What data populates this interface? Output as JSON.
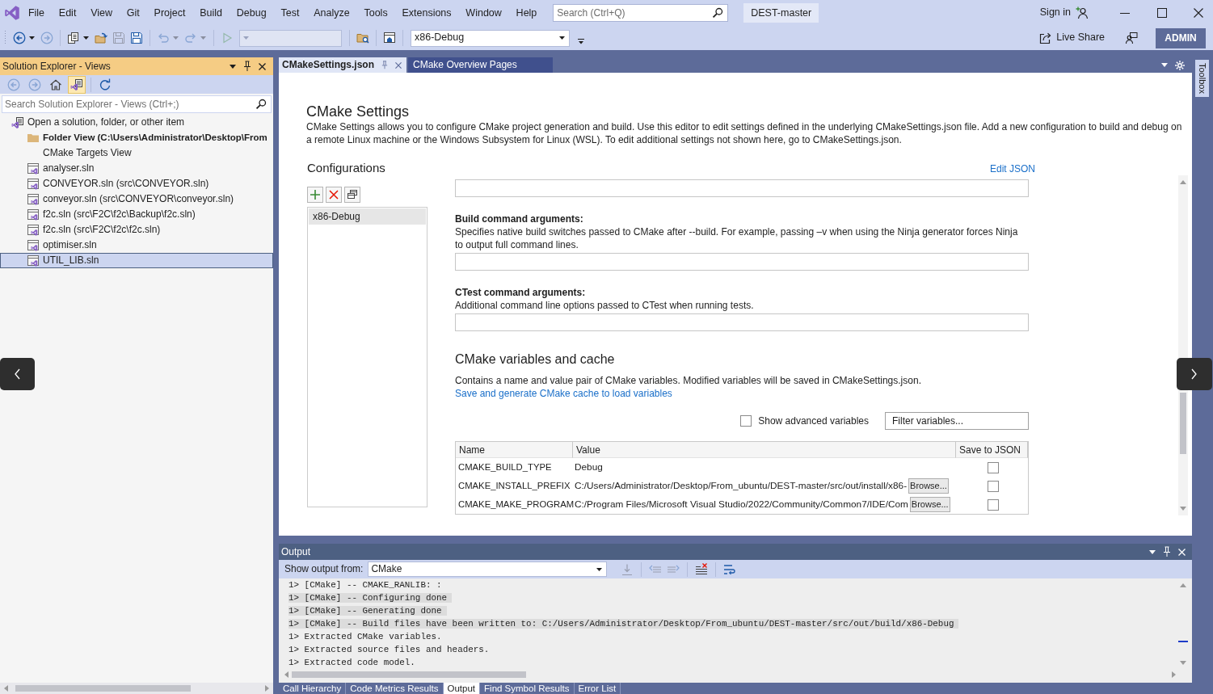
{
  "window": {
    "badge": "DEST-master",
    "sign_in": "Sign in",
    "account": "ADMIN"
  },
  "menu": [
    "File",
    "Edit",
    "View",
    "Git",
    "Project",
    "Build",
    "Debug",
    "Test",
    "Analyze",
    "Tools",
    "Extensions",
    "Window",
    "Help"
  ],
  "search": {
    "placeholder": "Search (Ctrl+Q)"
  },
  "toolbar": {
    "items": [
      {
        "kind": "back",
        "disabled": false,
        "dropdown": true
      },
      {
        "kind": "forward",
        "disabled": true,
        "dropdown": false
      },
      {
        "kind": "separator"
      },
      {
        "kind": "newitem",
        "disabled": false,
        "dropdown": true
      },
      {
        "kind": "open",
        "disabled": false,
        "dropdown": false
      },
      {
        "kind": "save",
        "disabled": true,
        "dropdown": false
      },
      {
        "kind": "saveall",
        "disabled": false,
        "dropdown": false
      },
      {
        "kind": "separator"
      },
      {
        "kind": "undo",
        "disabled": true,
        "dropdown": true
      },
      {
        "kind": "redo",
        "disabled": true,
        "dropdown": true
      },
      {
        "kind": "separator"
      },
      {
        "kind": "start",
        "disabled": true,
        "dropdown": false
      },
      {
        "kind": "combo",
        "disabled": true
      },
      {
        "kind": "separator"
      },
      {
        "kind": "findfolder",
        "disabled": false,
        "dropdown": false
      },
      {
        "kind": "separator"
      },
      {
        "kind": "window",
        "disabled": false,
        "dropdown": false
      },
      {
        "kind": "separator"
      },
      {
        "kind": "combo",
        "disabled": false,
        "value": "x86-Debug"
      },
      {
        "kind": "overflow"
      }
    ],
    "live_share": "Live Share"
  },
  "solution_explorer": {
    "title": "Solution Explorer - Views",
    "tools": [
      {
        "kind": "back",
        "disabled": true,
        "pressed": false
      },
      {
        "kind": "forward",
        "disabled": true,
        "pressed": false
      },
      {
        "kind": "home",
        "disabled": false,
        "pressed": false
      },
      {
        "kind": "views",
        "disabled": false,
        "pressed": true
      },
      {
        "kind": "separator"
      },
      {
        "kind": "refresh",
        "disabled": false,
        "pressed": false
      }
    ],
    "search": {
      "placeholder": "Search Solution Explorer - Views (Ctrl+;)"
    },
    "tree": [
      {
        "label": "Open a solution, folder, or other item",
        "kind": "root",
        "selected": false,
        "children": [
          {
            "label": "Folder View (C:\\Users\\Administrator\\Desktop\\From",
            "kind": "folder",
            "selected": false
          },
          {
            "label": "CMake Targets View",
            "kind": "view",
            "selected": false
          },
          {
            "label": "analyser.sln",
            "kind": "solution",
            "selected": false
          },
          {
            "label": "CONVEYOR.sln (src\\CONVEYOR.sln)",
            "kind": "solution",
            "selected": false
          },
          {
            "label": "conveyor.sln (src\\CONVEYOR\\conveyor.sln)",
            "kind": "solution",
            "selected": false
          },
          {
            "label": "f2c.sln (src\\F2C\\f2c\\Backup\\f2c.sln)",
            "kind": "solution",
            "selected": false
          },
          {
            "label": "f2c.sln (src\\F2C\\f2c\\f2c.sln)",
            "kind": "solution",
            "selected": false
          },
          {
            "label": "optimiser.sln",
            "kind": "solution",
            "selected": false
          },
          {
            "label": "UTIL_LIB.sln",
            "kind": "solution",
            "selected": true
          }
        ]
      }
    ]
  },
  "editor_tabs": [
    {
      "label": "CMakeSettings.json",
      "selected": true
    },
    {
      "label": "CMake Overview Pages",
      "selected": false
    }
  ],
  "cmake_settings": {
    "title": "CMake Settings",
    "description": "CMake Settings allows you to configure CMake project generation and build. Use this editor to edit settings defined in the underlying CMakeSettings.json file. Add a new configuration to build and debug on a remote Linux machine or the Windows Subsystem for Linux (WSL). To edit additional settings not shown here, go to CMakeSettings.json.",
    "configurations": {
      "heading": "Configurations",
      "edit_link": "Edit JSON",
      "items": [
        {
          "label": "x86-Debug",
          "selected": true
        }
      ]
    },
    "settings": [
      {
        "kind": "field"
      },
      {
        "kind": "argument",
        "label": "Build command arguments:",
        "description": "Specifies native build switches passed to CMake after --build. For example, passing –v when using the Ninja generator forces Ninja to output full command lines."
      },
      {
        "kind": "argument",
        "label": "CTest command arguments:",
        "description": "Additional command line options passed to CTest when running tests."
      }
    ],
    "variables": {
      "heading": "CMake variables and cache",
      "description": "Contains a name and value pair of CMake variables. Modified variables will be saved in CMakeSettings.json.",
      "link": "Save and generate CMake cache to load variables",
      "show_advanced": {
        "label": "Show advanced variables",
        "checked": false
      },
      "filter": {
        "placeholder": "Filter variables..."
      },
      "columns": [
        "Name",
        "Value",
        "Save to JSON"
      ],
      "rows": [
        {
          "name": "CMAKE_BUILD_TYPE",
          "value": "Debug",
          "save": false
        },
        {
          "name": "CMAKE_INSTALL_PREFIX",
          "value": "C:/Users/Administrator/Desktop/From_ubuntu/DEST-master/src/out/install/x86-",
          "browse": "Browse...",
          "save": false
        },
        {
          "name": "CMAKE_MAKE_PROGRAM",
          "value": "C:/Program Files/Microsoft Visual Studio/2022/Community/Common7/IDE/Com",
          "browse": "Browse...",
          "save": false
        }
      ]
    }
  },
  "toolbox": {
    "label": "Toolbox"
  },
  "output": {
    "title": "Output",
    "source_label": "Show output from:",
    "source": "CMake",
    "tools": [
      {
        "kind": "goto",
        "disabled": true
      },
      {
        "kind": "separator"
      },
      {
        "kind": "previous",
        "disabled": true
      },
      {
        "kind": "next",
        "disabled": true
      },
      {
        "kind": "separator"
      },
      {
        "kind": "clear",
        "disabled": false
      },
      {
        "kind": "separator"
      },
      {
        "kind": "wordwrap",
        "disabled": false
      }
    ],
    "lines": [
      {
        "text": "1> [CMake] -- CMAKE_RANLIB: :",
        "highlighted": false
      },
      {
        "text": "1> [CMake] -- Configuring done",
        "highlighted": true
      },
      {
        "text": "1> [CMake] -- Generating done",
        "highlighted": true
      },
      {
        "text": "1> [CMake] -- Build files have been written to: C:/Users/Administrator/Desktop/From_ubuntu/DEST-master/src/out/build/x86-Debug",
        "highlighted": true
      },
      {
        "text": "1> Extracted CMake variables.",
        "highlighted": false
      },
      {
        "text": "1> Extracted source files and headers.",
        "highlighted": false
      },
      {
        "text": "1> Extracted code model.",
        "highlighted": false
      }
    ]
  },
  "bottom_tabs": [
    {
      "label": "Call Hierarchy",
      "selected": false
    },
    {
      "label": "Code Metrics Results",
      "selected": false
    },
    {
      "label": "Output",
      "selected": true
    },
    {
      "label": "Find Symbol Results",
      "selected": false
    },
    {
      "label": "Error List",
      "selected": false
    }
  ]
}
